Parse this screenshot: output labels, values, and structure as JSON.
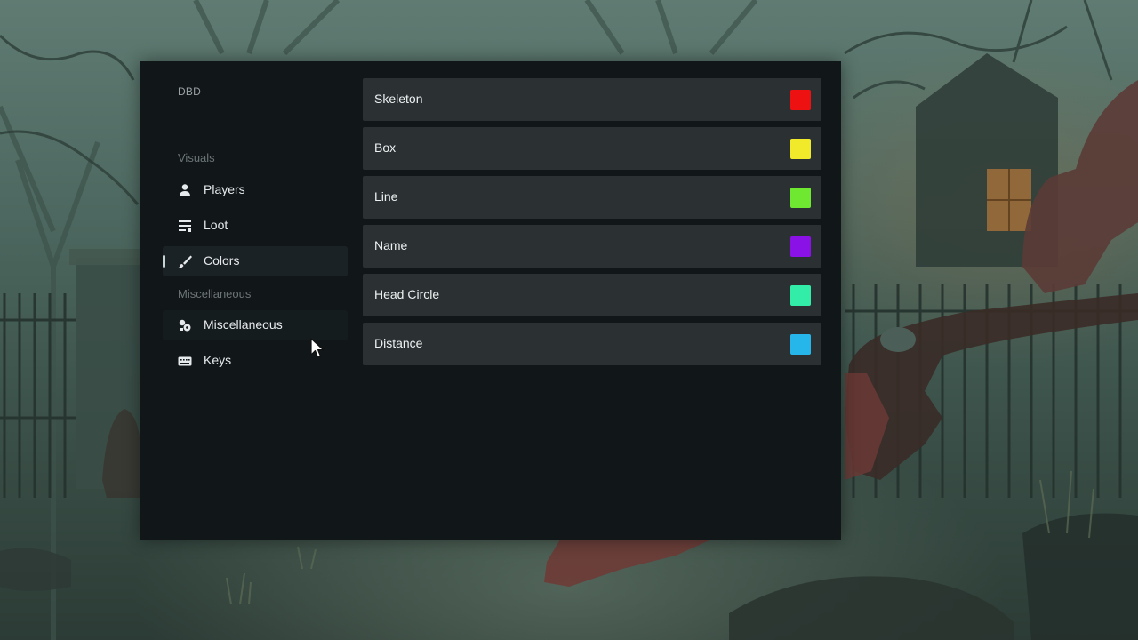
{
  "app": {
    "title": "DBD"
  },
  "sidebar": {
    "sections": [
      {
        "label": "Visuals",
        "items": [
          {
            "label": "Players",
            "icon": "person-icon",
            "active": false
          },
          {
            "label": "Loot",
            "icon": "list-icon",
            "active": false
          },
          {
            "label": "Colors",
            "icon": "brush-icon",
            "active": true
          }
        ]
      },
      {
        "label": "Miscellaneous",
        "items": [
          {
            "label": "Miscellaneous",
            "icon": "gear-cluster-icon",
            "active": false
          },
          {
            "label": "Keys",
            "icon": "keyboard-icon",
            "active": false
          }
        ]
      }
    ]
  },
  "colors": {
    "rows": [
      {
        "label": "Skeleton",
        "color": "#ee1111"
      },
      {
        "label": "Box",
        "color": "#f0ea2a"
      },
      {
        "label": "Line",
        "color": "#6ee830"
      },
      {
        "label": "Name",
        "color": "#8a12e6"
      },
      {
        "label": "Head Circle",
        "color": "#32eda8"
      },
      {
        "label": "Distance",
        "color": "#27b6ea"
      }
    ]
  },
  "theme": {
    "panel_bg": "#111719",
    "row_bg": "#2b3133",
    "active_item_bg": "#1b2225",
    "text_primary": "#e6eaec",
    "text_muted": "#6c7477"
  }
}
